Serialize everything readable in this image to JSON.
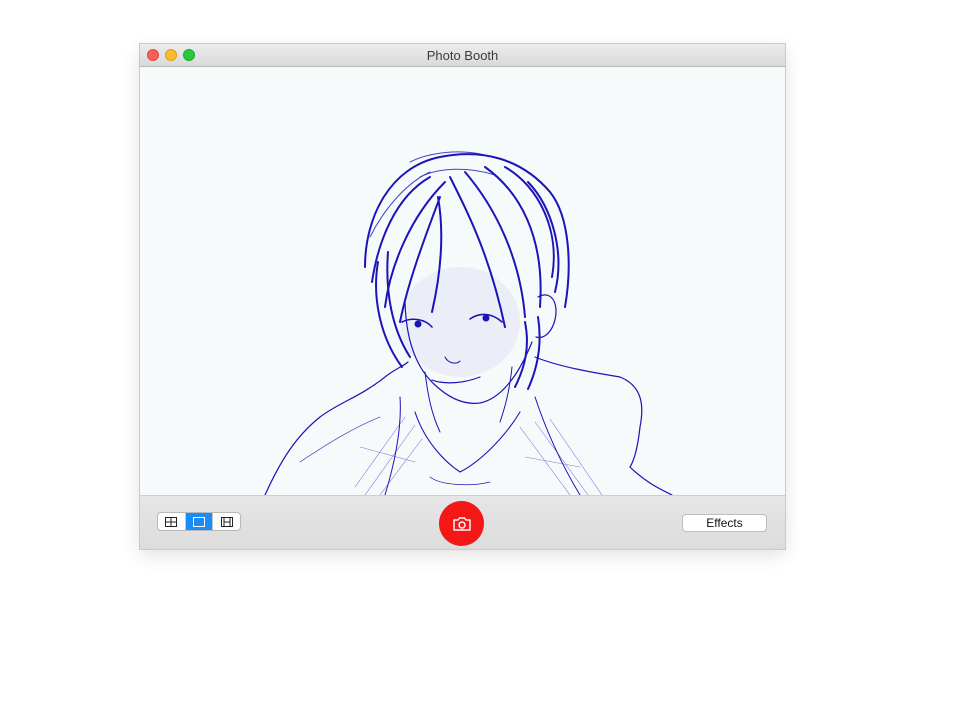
{
  "window": {
    "title": "Photo Booth"
  },
  "toolbar": {
    "view_modes": [
      {
        "icon": "four-up-grid-icon",
        "active": false
      },
      {
        "icon": "single-frame-icon",
        "active": true
      },
      {
        "icon": "film-strip-icon",
        "active": false
      }
    ],
    "shutter_icon": "camera-icon",
    "effects_label": "Effects"
  },
  "colors": {
    "shutter": "#f51616",
    "active_segment": "#1a8cf5",
    "sketch_ink": "#1c14b8"
  }
}
